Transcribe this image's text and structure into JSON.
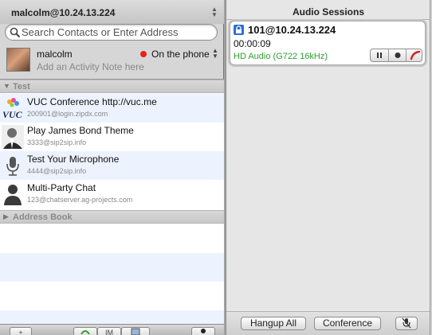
{
  "account": {
    "name": "malcolm@10.24.13.224"
  },
  "search": {
    "placeholder": "Search Contacts or Enter Address"
  },
  "me": {
    "name": "malcolm",
    "status": "On the phone",
    "status_color": "#e52020",
    "activity_placeholder": "Add an Activity Note here"
  },
  "groups": [
    {
      "label": "Test",
      "expanded": true,
      "contacts": [
        {
          "name": "VUC Conference http://vuc.me",
          "uri": "200901@login.zipdx.com",
          "icon": "vuc-logo"
        },
        {
          "name": "Play James Bond Theme",
          "uri": "3333@sip2sip.info",
          "icon": "james-bond-avatar"
        },
        {
          "name": "Test Your Microphone",
          "uri": "4444@sip2sip.info",
          "icon": "microphone-icon"
        },
        {
          "name": "Multi-Party Chat",
          "uri": "123@chatserver.ag-projects.com",
          "icon": "person-silhouette-icon"
        }
      ]
    },
    {
      "label": "Address Book",
      "expanded": false,
      "contacts": []
    }
  ],
  "bottom_bar": {
    "add_label": "+",
    "im_label": "IM"
  },
  "sessions": {
    "header": "Audio Sessions",
    "active": {
      "uri": "101@10.24.13.224",
      "duration": "00:00:09",
      "codec": "HD Audio (G722 16kHz)",
      "codec_color": "#2fa12f"
    },
    "footer": {
      "hangup_all": "Hangup All",
      "conference": "Conference"
    }
  }
}
